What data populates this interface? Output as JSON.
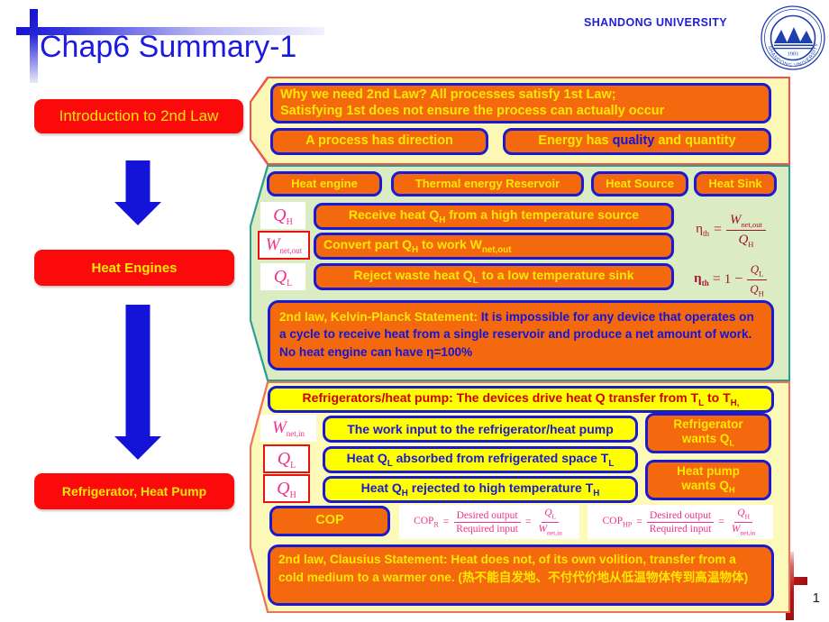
{
  "slide": {
    "title": "Chap6 Summary-1",
    "page_number": "1",
    "brand": "SHANDONG UNIVERSITY",
    "logo_year": "1901",
    "logo_arc_text": "SHANDONG UNIVERSITY"
  },
  "rail": {
    "intro": "Introduction to 2nd Law",
    "engines": "Heat Engines",
    "fridge": "Refrigerator, Heat Pump"
  },
  "intro_panel": {
    "why_line1": "Why we need 2nd Law?  All processes satisfy 1st Law;",
    "why_line2": "Satisfying 1st does not ensure the process can actually occur",
    "direction": "A process has direction",
    "quality_pre": "Energy has ",
    "quality_hl": "quality",
    "quality_post": " and quantity"
  },
  "engine_panel": {
    "tags": [
      "Heat engine",
      "Thermal energy Reservoir",
      "Heat Source",
      "Heat Sink"
    ],
    "rows": [
      "Receive heat QH from a high temperature source",
      "Convert part QH to work Wnet,out",
      "Reject waste heat QL to a low temperature sink"
    ],
    "symbols": [
      "QH",
      "Wnet,out",
      "QL"
    ],
    "efficiency_1": "ηth = Wnet,out / QH",
    "efficiency_2": "ηth = 1 − QL / QH",
    "kelvin_planck_main": "2nd law, Kelvin-Planck Statement:",
    "kelvin_planck_body": " It is impossible for any device that operates on a cycle to receive heat from a single reservoir and produce a net amount of work. ",
    "kelvin_planck_tail": "No heat engine can have η=100%"
  },
  "fridge_panel": {
    "header": "Refrigerators/heat pump: The devices drive heat Q transfer from TL to TH,",
    "rows": [
      "The work input to the refrigerator/heat pump",
      "Heat QL absorbed from refrigerated space TL",
      "Heat QH rejected to high temperature TH"
    ],
    "symbols": [
      "Wnet,in",
      "QL",
      "QH"
    ],
    "want_refrigerator": "Refrigerator wants QL",
    "want_heatpump": "Heat pump wants QH",
    "cop_label": "COP",
    "cop_r": "COPR = Desired output / Required input = QL / Wnet,in",
    "cop_hp": "COPHP = Desired output / Required input = QH / Wnet,in",
    "cop_numerator": "Desired output",
    "cop_denominator": "Required input",
    "clausius_main": "2nd law, Clausius Statement:",
    "clausius_body": " Heat does not, of its own volition, transfer from a cold medium to a warmer one. (热不能自发地、不付代价地从低温物体传到高温物体)"
  },
  "colors": {
    "title_blue": "#1a1ae0",
    "rail_red": "#fa0a0a",
    "pill_orange": "#f4690d",
    "pill_yellow": "#ffff00",
    "border_blue": "#1a1ad0",
    "text_yellow": "#ffe800",
    "symbol_pink": "#f0328c",
    "formula_maroon": "#a01434",
    "panel_intro_bg": "#fcf7b4",
    "panel_engine_bg": "#dcecc2",
    "panel_fridge_bg": "#fdf9b8"
  }
}
